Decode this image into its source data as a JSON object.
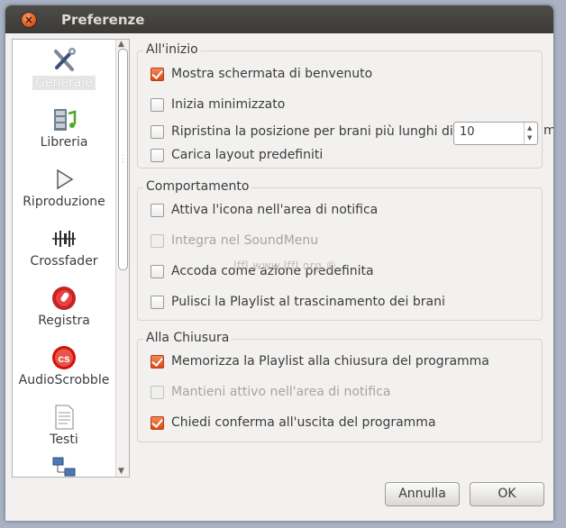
{
  "window": {
    "title": "Preferenze",
    "close_glyph": "×",
    "minimize_glyph": "–"
  },
  "sidebar": {
    "items": [
      {
        "label": "Generale",
        "icon": "tools-icon",
        "selected": true
      },
      {
        "label": "Libreria",
        "icon": "library-icon",
        "selected": false
      },
      {
        "label": "Riproduzione",
        "icon": "play-icon",
        "selected": false
      },
      {
        "label": "Crossfader",
        "icon": "crossfader-icon",
        "selected": false
      },
      {
        "label": "Registra",
        "icon": "record-icon",
        "selected": false
      },
      {
        "label": "AudioScrobble",
        "icon": "lastfm-icon",
        "selected": false
      },
      {
        "label": "Testi",
        "icon": "lyrics-icon",
        "selected": false
      },
      {
        "label": "",
        "icon": "network-icon",
        "selected": false
      }
    ]
  },
  "groups": {
    "startup": {
      "title": "All'inizio",
      "show_welcome": {
        "label": "Mostra schermata di benvenuto",
        "checked": true
      },
      "start_minimized": {
        "label": "Inizia minimizzato",
        "checked": false
      },
      "resume_position": {
        "label": "Ripristina la posizione per brani più lunghi di",
        "checked": false,
        "value": "10",
        "unit": "mi"
      },
      "load_layout": {
        "label": "Carica layout predefiniti",
        "checked": false
      }
    },
    "behavior": {
      "title": "Comportamento",
      "tray_icon": {
        "label": "Attiva l'icona nell'area di notifica",
        "checked": false
      },
      "sound_menu": {
        "label": "Integra nel SoundMenu",
        "checked": false,
        "disabled": true
      },
      "enqueue_default": {
        "label": "Accoda come azione predefinita",
        "checked": false
      },
      "clear_playlist": {
        "label": "Pulisci la Playlist al trascinamento dei brani",
        "checked": false
      }
    },
    "closing": {
      "title": "Alla Chiusura",
      "remember_playlist": {
        "label": "Memorizza la Playlist alla chiusura del programma",
        "checked": true
      },
      "keep_in_tray": {
        "label": "Mantieni attivo nell'area di notifica",
        "checked": true,
        "disabled": true
      },
      "confirm_exit": {
        "label": "Chiedi conferma all'uscita del programma",
        "checked": true
      }
    }
  },
  "watermark": "lffl www.lffl.org ©",
  "buttons": {
    "cancel": "Annulla",
    "ok": "OK"
  },
  "colors": {
    "accent": "#dd4814",
    "titlebar": "#3c3b37"
  }
}
